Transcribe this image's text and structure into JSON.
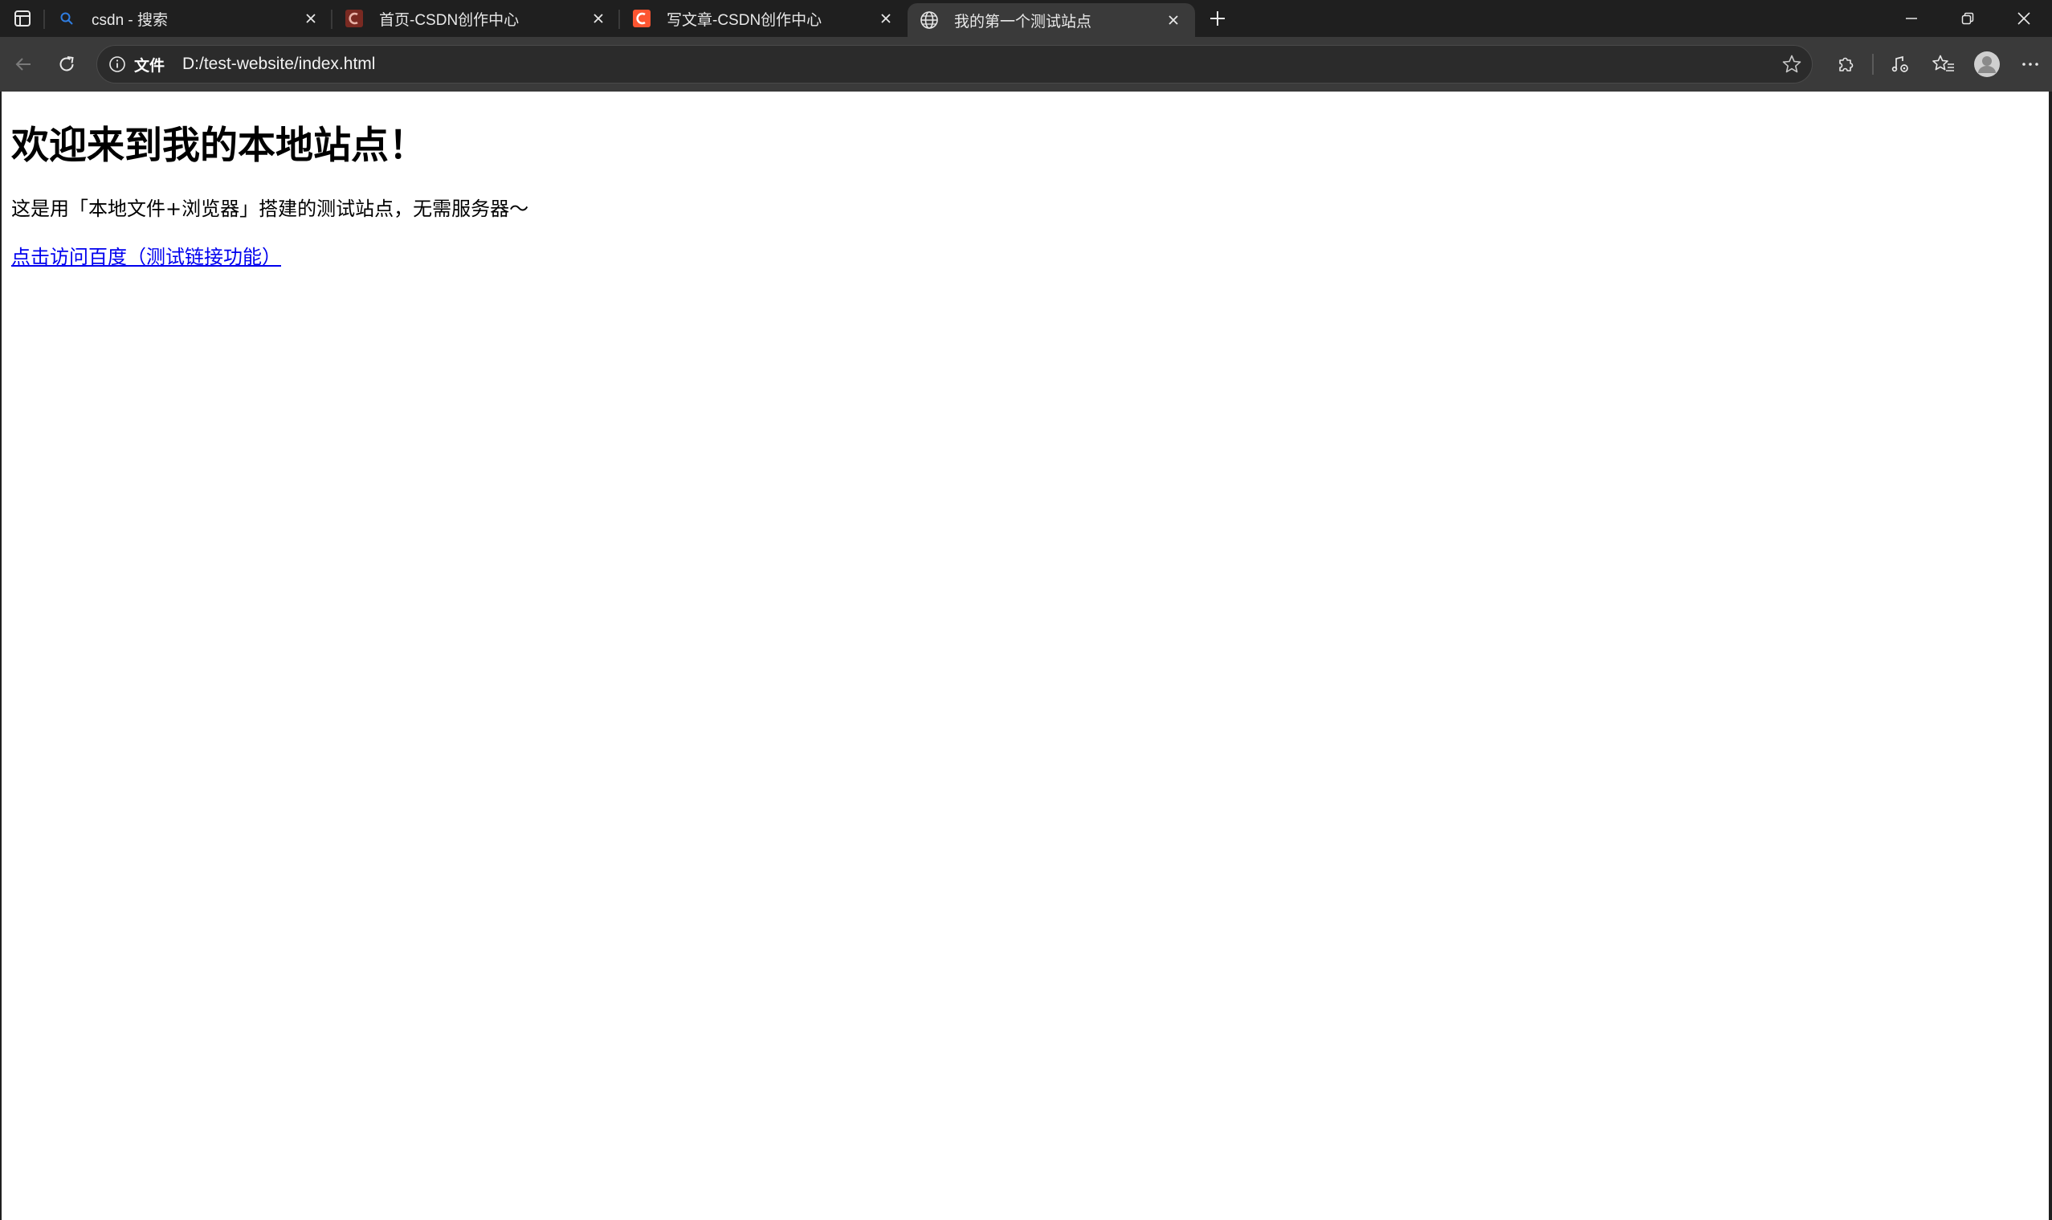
{
  "browser": {
    "tabs": [
      {
        "title": "csdn - 搜索",
        "favicon": "search-favicon",
        "active": false
      },
      {
        "title": "首页-CSDN创作中心",
        "favicon": "csdn-favicon-dark",
        "active": false
      },
      {
        "title": "写文章-CSDN创作中心",
        "favicon": "csdn-favicon",
        "active": false
      },
      {
        "title": "我的第一个测试站点",
        "favicon": "globe-icon",
        "active": true
      }
    ],
    "address": {
      "scheme_label": "文件",
      "url": "D:/test-website/index.html"
    },
    "colors": {
      "chrome_bg": "#1f1f1f",
      "toolbar_bg": "#3a3a3a",
      "csdn_red": "#fc5531"
    }
  },
  "page": {
    "heading": "欢迎来到我的本地站点！",
    "description": "这是用「本地文件+浏览器」搭建的测试站点，无需服务器～",
    "link_text": "点击访问百度（测试链接功能）"
  }
}
